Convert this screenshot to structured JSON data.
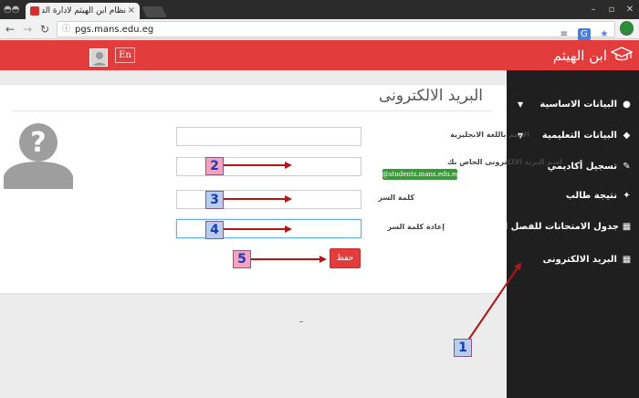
{
  "browser": {
    "tab_title": "نظام ابن الهيثم لادارة الدراسات",
    "url": "pgs.mans.edu.eg"
  },
  "header": {
    "brand": "ابن الهيثم",
    "lang_button": "En"
  },
  "sidebar": {
    "items": [
      {
        "label": "البيانات الاساسية",
        "icon": "user-icon",
        "caret": true
      },
      {
        "label": "البيانات التعليمية",
        "icon": "graduation-cap-icon",
        "caret": true
      },
      {
        "label": "تسجيل أكاديمي",
        "icon": "edit-icon",
        "caret": false
      },
      {
        "label": "نتيجة طالب",
        "icon": "wand-icon",
        "caret": false
      },
      {
        "label": "جدول الامتحانات للفصل الحالي",
        "icon": "table-icon",
        "caret": false
      },
      {
        "label": "البريد الالكترونى",
        "icon": "table-icon",
        "caret": false
      }
    ]
  },
  "main": {
    "title": "البريد الالكترونى",
    "fields": {
      "name_en_label": "الاسم باللغة الانجليزية",
      "email_label": "اسم البريد الالكترونى الخاص بك",
      "email_domain": "@students.mans.edu.eg",
      "password_label": "كلمة السر",
      "password_confirm_label": "إعادة كلمة السر"
    },
    "save_label": "حفظ"
  },
  "annotations": {
    "m1": "1",
    "m2": "2",
    "m3": "3",
    "m4": "4",
    "m5": "5",
    "arrow_color": "#b01818"
  }
}
